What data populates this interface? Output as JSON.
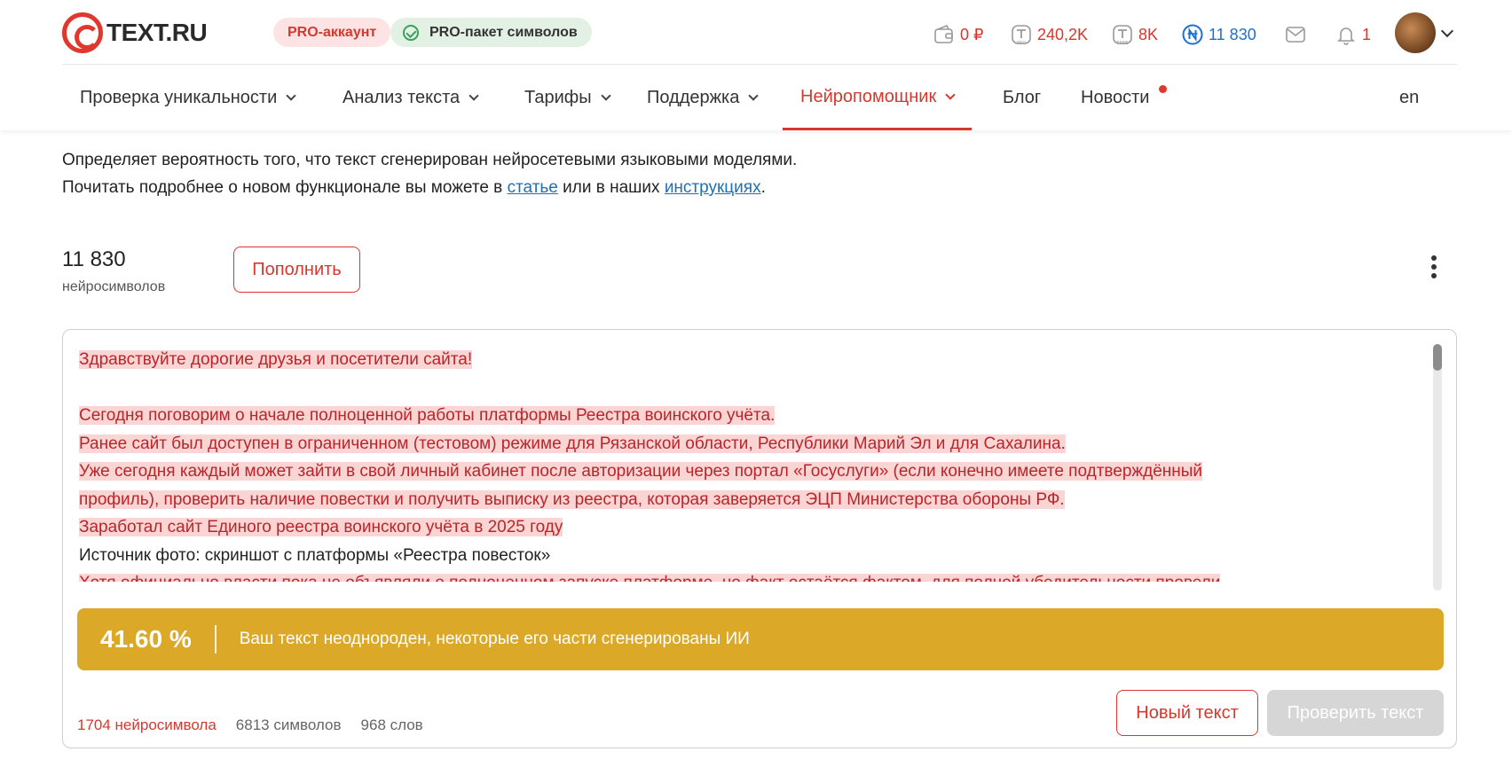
{
  "brand": {
    "name": "TEXT.RU"
  },
  "badges": {
    "pro_account": "PRO-аккаунт",
    "pro_pack": "PRO-пакет символов"
  },
  "stats": {
    "wallet": "0 ₽",
    "pro_symbols": "240,2K",
    "free_symbols": "8K",
    "neuro_symbols": "11 830",
    "notifications": "1"
  },
  "icons": {
    "wallet": "wallet-icon",
    "pro": "pro-symbols-icon",
    "free": "free-symbols-icon",
    "neuro": "neuro-coin-icon",
    "mail": "mail-icon",
    "bell": "bell-icon"
  },
  "nav": {
    "items": [
      {
        "label": "Проверка уникальности",
        "dropdown": true
      },
      {
        "label": "Анализ текста",
        "dropdown": true
      },
      {
        "label": "Тарифы",
        "dropdown": true
      },
      {
        "label": "Поддержка",
        "dropdown": true
      },
      {
        "label": "Нейропомощник",
        "dropdown": true,
        "active": true
      },
      {
        "label": "Блог",
        "dropdown": false
      },
      {
        "label": "Новости",
        "dropdown": false,
        "dot": true
      }
    ],
    "lang": "en"
  },
  "intro": {
    "line1": "Определяет вероятность того, что текст сгенерирован нейросетевыми языковыми моделями.",
    "line2_prefix": "Почитать подробнее о новом функционале вы можете в ",
    "link1": "статье",
    "line2_middle": " или в наших ",
    "link2": "инструкциях",
    "line2_suffix": "."
  },
  "balance": {
    "value": "11 830",
    "label": "нейросимволов",
    "topup_button": "Пополнить"
  },
  "editor": {
    "lines": [
      {
        "text": "Здравствуйте дорогие друзья и посетители сайта!",
        "ai": true
      },
      {
        "text": "",
        "ai": false
      },
      {
        "text": "Сегодня поговорим о начале полноценной работы платформы Реестра воинского учёта.",
        "ai": true
      },
      {
        "text": "Ранее сайт был доступен в ограниченном (тестовом) режиме для Рязанской области, Республики Марий Эл и для Сахалина.",
        "ai": true
      },
      {
        "text": "Уже сегодня каждый может зайти в свой личный кабинет после авторизации через портал «Госуслуги» (если конечно имеете подтверждённый",
        "ai": true
      },
      {
        "text": "профиль), проверить наличие повестки и получить выписку из реестра, которая заверяется ЭЦП Министерства обороны РФ.",
        "ai": true
      },
      {
        "text": "Заработал сайт Единого реестра воинского учёта в 2025 году",
        "ai": true
      },
      {
        "text": "Источник фото: скриншот с платформы «Реестра повесток»",
        "ai": false
      },
      {
        "text": "Хотя официально власти пока не объявляли о полноценном запуске платформе, но факт остаётся фактом, для полной убедительности провели",
        "ai": true
      }
    ]
  },
  "result": {
    "percent": "41.60 %",
    "message": "Ваш текст неоднороден, некоторые его части сгенерированы ИИ",
    "color": "#dba927"
  },
  "counts": {
    "neuro": "1704 нейросимвола",
    "chars": "6813 символов",
    "words": "968 слов"
  },
  "actions": {
    "new_text": "Новый текст",
    "check_text": "Проверить текст"
  },
  "colors": {
    "accent": "#d8372d",
    "link": "#1f6fb5",
    "neuro": "#1f6fd0",
    "highlight": "#fbd4d4"
  }
}
